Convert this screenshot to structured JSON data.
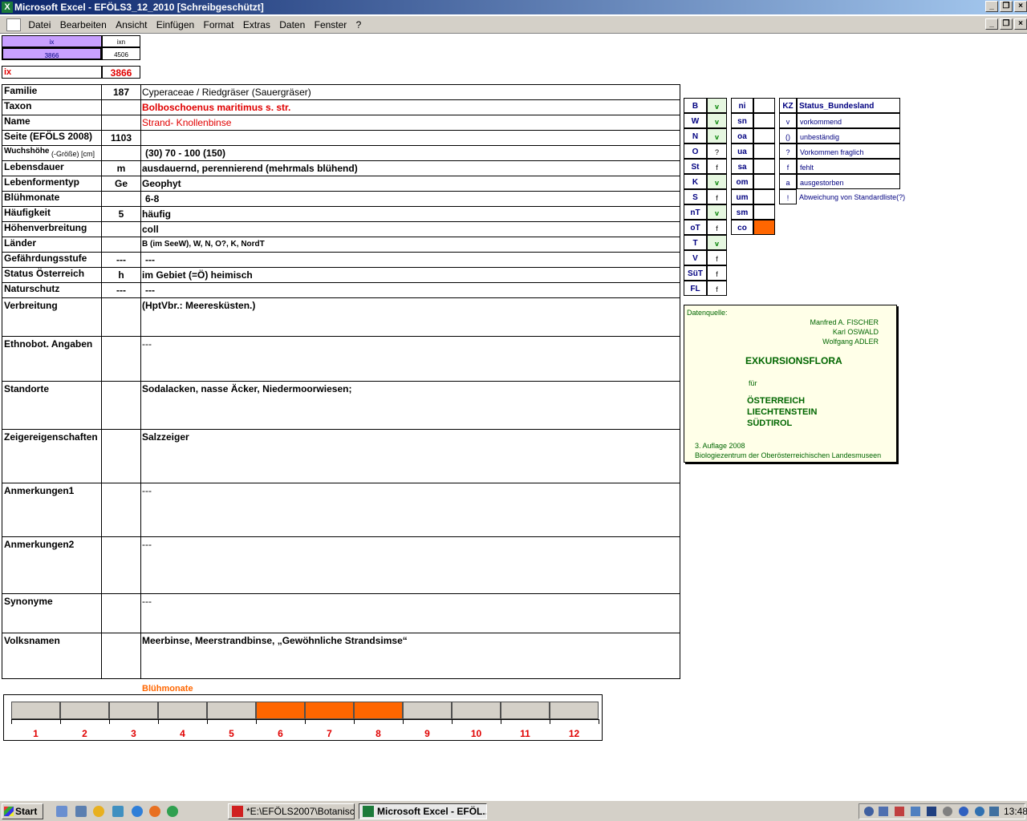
{
  "window": {
    "app_title": "Microsoft Excel - EFÖLS3_12_2010  [Schreibgeschützt]"
  },
  "menu": [
    "Datei",
    "Bearbeiten",
    "Ansicht",
    "Einfügen",
    "Format",
    "Extras",
    "Daten",
    "Fenster",
    "?"
  ],
  "top_index": {
    "ix_label": "ix",
    "ixn_label": "ixn",
    "ix_value": "3866",
    "ixn_value": "4506",
    "ix_big_label": "ix",
    "ix_big_value": "3866"
  },
  "rows": [
    {
      "label": "Familie",
      "code": "187",
      "value": "Cyperaceae  /  Riedgräser (Sauergräser)"
    },
    {
      "label": "Taxon",
      "code": "",
      "value": "Bolboschoenus maritimus s. str."
    },
    {
      "label": "Name",
      "code": "",
      "value": "Strand- Knollenbinse"
    },
    {
      "label": "Seite (EFÖLS 2008)",
      "code": "1103",
      "value": ""
    },
    {
      "label": "Wuchshöhe",
      "label_suffix": "(-Größe) [cm]",
      "code": "",
      "value": "(30) 70 - 100 (150)"
    },
    {
      "label": "Lebensdauer",
      "code": "m",
      "value": "ausdauernd, perennierend (mehrmals blühend)"
    },
    {
      "label": "Lebenformentyp",
      "code": "Ge",
      "value": "Geophyt"
    },
    {
      "label": "Blühmonate",
      "code": "",
      "value": "6-8"
    },
    {
      "label": "Häufigkeit",
      "code": "5",
      "value": "häufig"
    },
    {
      "label": "Höhenverbreitung",
      "code": "",
      "value": "coll"
    },
    {
      "label": "Länder",
      "code": "",
      "value": "B (im SeeW), W, N, O?, K, NordT"
    },
    {
      "label": "Gefährdungsstufe",
      "code": "---",
      "value": "---"
    },
    {
      "label": "Status Österreich",
      "code": "h",
      "value": "im Gebiet (=Ö) heimisch"
    },
    {
      "label": "Naturschutz",
      "code": "---",
      "value": "---"
    }
  ],
  "big_rows": [
    {
      "label": "Verbreitung",
      "value": "(HptVbr.: Meeresküsten.)"
    },
    {
      "label": "Ethnobot. Angaben",
      "value": "---"
    },
    {
      "label": "Standorte",
      "value": "Sodalacken, nasse Äcker, Niedermoorwiesen;"
    },
    {
      "label": "Zeigereigenschaften",
      "value": "Salzzeiger"
    },
    {
      "label": "Anmerkungen1",
      "value": "---"
    },
    {
      "label": "Anmerkungen2",
      "value": "---"
    },
    {
      "label": "Synonyme",
      "value": "---"
    },
    {
      "label": "Volksnamen",
      "value": "Meerbinse, Meerstrandbinse,   „Gewöhnliche Strandsimse“"
    }
  ],
  "states": [
    {
      "code": "B",
      "status": "v"
    },
    {
      "code": "W",
      "status": "v"
    },
    {
      "code": "N",
      "status": "v"
    },
    {
      "code": "O",
      "status": "?"
    },
    {
      "code": "St",
      "status": "f"
    },
    {
      "code": "K",
      "status": "v"
    },
    {
      "code": "S",
      "status": "f"
    },
    {
      "code": "nT",
      "status": "v"
    },
    {
      "code": "oT",
      "status": "f"
    },
    {
      "code": "T",
      "status": "v"
    },
    {
      "code": "V",
      "status": "f"
    },
    {
      "code": "SüT",
      "status": "f"
    },
    {
      "code": "FL",
      "status": "f"
    }
  ],
  "altitude_codes": [
    "ni",
    "sn",
    "oa",
    "ua",
    "sa",
    "om",
    "um",
    "sm",
    "co"
  ],
  "legend": {
    "header_kz": "KZ",
    "header_status": "Status_Bundesland",
    "items": [
      {
        "kz": "v",
        "text": "vorkommend"
      },
      {
        "kz": "()",
        "text": "unbeständig"
      },
      {
        "kz": "?",
        "text": "Vorkommen fraglich"
      },
      {
        "kz": "f",
        "text": "fehlt"
      },
      {
        "kz": "a",
        "text": "ausgestorben"
      },
      {
        "kz": "!",
        "text": "Abweichung von Standardliste(?)"
      }
    ]
  },
  "source": {
    "heading": "Datenquelle:",
    "authors": [
      "Manfred A. FISCHER",
      "Karl OSWALD",
      "Wolfgang ADLER"
    ],
    "title": "EXKURSIONSFLORA",
    "fuer": "für",
    "countries": [
      "ÖSTERREICH",
      "LIECHTENSTEIN",
      "SÜDTIROL"
    ],
    "edition": "3. Auflage 2008",
    "publisher": "Biologiezentrum der Oberösterreichischen Landesmuseen"
  },
  "months": {
    "label": "Blühmonate",
    "numbers": [
      "1",
      "2",
      "3",
      "4",
      "5",
      "6",
      "7",
      "8",
      "9",
      "10",
      "11",
      "12"
    ],
    "active": [
      6,
      7,
      8
    ]
  },
  "colors": {
    "active_month": "#ff6600",
    "inactive_month": "#d4d0c8",
    "red": "#e00000",
    "purple": "#c8a0ff"
  },
  "taskbar": {
    "start": "Start",
    "tasks": [
      "*E:\\EFÖLS2007\\Botanisc...",
      "Microsoft Excel - EFÖL..."
    ],
    "clock": "13:48"
  }
}
